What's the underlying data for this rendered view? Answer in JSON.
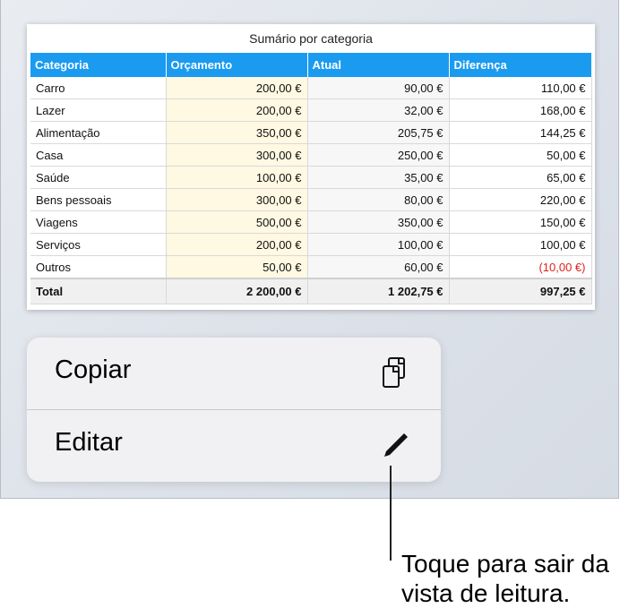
{
  "table": {
    "title": "Sumário por categoria",
    "headers": [
      "Categoria",
      "Orçamento",
      "Atual",
      "Diferença"
    ],
    "rows": [
      {
        "category": "Carro",
        "budget": "200,00 €",
        "actual": "90,00 €",
        "difference": "110,00 €"
      },
      {
        "category": "Lazer",
        "budget": "200,00 €",
        "actual": "32,00 €",
        "difference": "168,00 €"
      },
      {
        "category": "Alimentação",
        "budget": "350,00 €",
        "actual": "205,75 €",
        "difference": "144,25 €"
      },
      {
        "category": "Casa",
        "budget": "300,00 €",
        "actual": "250,00 €",
        "difference": "50,00 €"
      },
      {
        "category": "Saúde",
        "budget": "100,00 €",
        "actual": "35,00 €",
        "difference": "65,00 €"
      },
      {
        "category": "Bens pessoais",
        "budget": "300,00 €",
        "actual": "80,00 €",
        "difference": "220,00 €"
      },
      {
        "category": "Viagens",
        "budget": "500,00 €",
        "actual": "350,00 €",
        "difference": "150,00 €"
      },
      {
        "category": "Serviços",
        "budget": "200,00 €",
        "actual": "100,00 €",
        "difference": "100,00 €"
      },
      {
        "category": "Outros",
        "budget": "50,00 €",
        "actual": "60,00 €",
        "difference": "(10,00 €)",
        "negative": true
      }
    ],
    "total": {
      "label": "Total",
      "budget": "2 200,00 €",
      "actual": "1 202,75 €",
      "difference": "997,25 €"
    }
  },
  "menu": {
    "copy_label": "Copiar",
    "copy_icon": "copy-icon",
    "edit_label": "Editar",
    "edit_icon": "pencil-icon"
  },
  "callout": {
    "line1": "Toque para sair da",
    "line2": "vista de leitura."
  },
  "colors": {
    "header": "#1a9bf0",
    "budget_fill": "#fff8e2",
    "negative": "#e0201e"
  }
}
